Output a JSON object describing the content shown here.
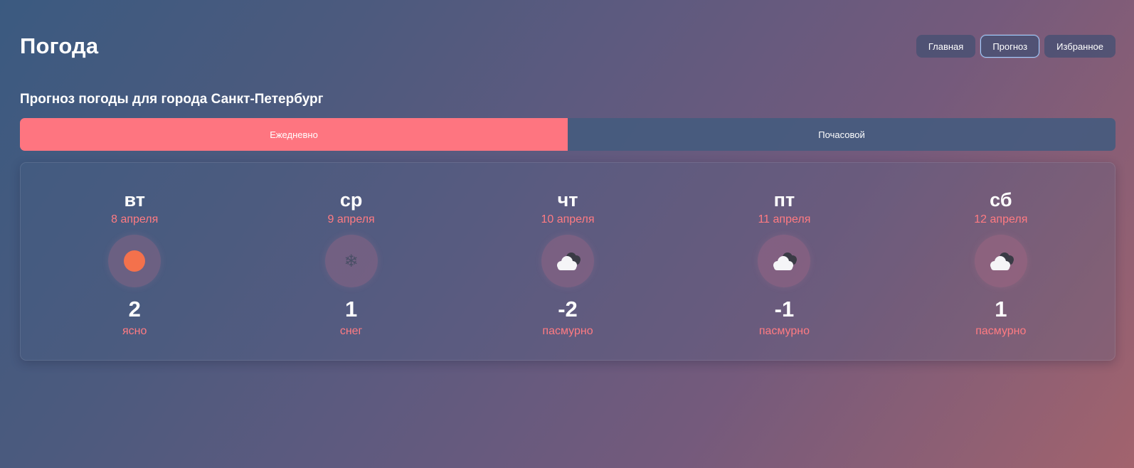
{
  "app": {
    "title": "Погода"
  },
  "nav": {
    "items": [
      {
        "label": "Главная",
        "active": false
      },
      {
        "label": "Прогноз",
        "active": true
      },
      {
        "label": "Избранное",
        "active": false
      }
    ]
  },
  "main": {
    "heading": "Прогноз погоды для города Санкт-Петербург",
    "mode_tabs": [
      {
        "label": "Ежедневно",
        "active": true
      },
      {
        "label": "Почасовой",
        "active": false
      }
    ]
  },
  "forecast": {
    "days": [
      {
        "day": "вт",
        "date": "8 апреля",
        "icon": "sun-icon",
        "temp": "2",
        "condition": "ясно"
      },
      {
        "day": "ср",
        "date": "9 апреля",
        "icon": "snowflake-icon",
        "temp": "1",
        "condition": "снег"
      },
      {
        "day": "чт",
        "date": "10 апреля",
        "icon": "cloud-icon",
        "temp": "-2",
        "condition": "пасмурно"
      },
      {
        "day": "пт",
        "date": "11 апреля",
        "icon": "cloud-icon",
        "temp": "-1",
        "condition": "пасмурно"
      },
      {
        "day": "сб",
        "date": "12 апреля",
        "icon": "cloud-icon",
        "temp": "1",
        "condition": "пасмурно"
      }
    ]
  },
  "colors": {
    "accent": "#fe7580",
    "date_text": "#ff7b82",
    "sun": "#f4714c",
    "nav_active_border": "#9ecbff"
  }
}
